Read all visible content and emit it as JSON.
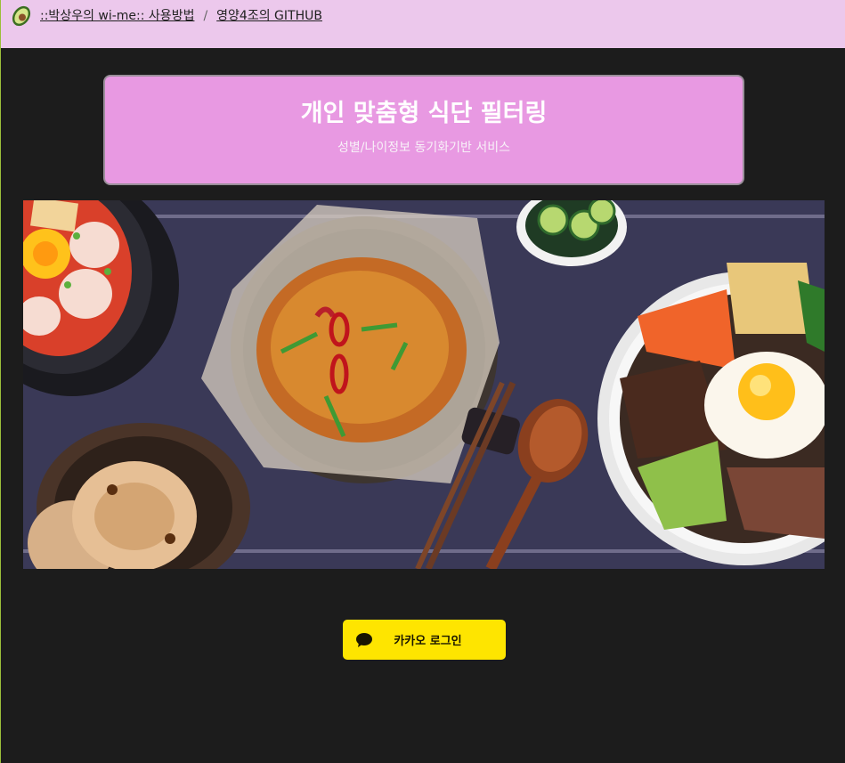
{
  "breadcrumb": {
    "items": [
      {
        "label": "::박상우의 wi-me:: 사용방법"
      },
      {
        "label": "영양4조의 GITHUB"
      }
    ],
    "separator": "/"
  },
  "hero": {
    "title": "개인 맞춤형 식단 필터링",
    "subtitle": "성별/나이정보 동기화기반 서비스"
  },
  "login": {
    "kakao_label": "카카오 로그인"
  },
  "colors": {
    "topbar": "#ecc8ec",
    "hero_card": "#e899e2",
    "background": "#1c1c1c",
    "kakao": "#fee500"
  },
  "icons": {
    "logo": "avocado-icon",
    "login": "speech-bubble-icon"
  }
}
